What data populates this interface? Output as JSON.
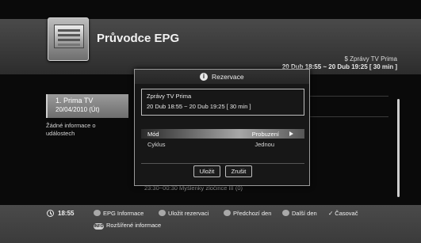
{
  "header": {
    "title": "Průvodce EPG",
    "current_channel": "$ Zprávy TV Prima",
    "current_time": "20 Dub 18:55 ~ 20 Dub 19:25 [ 30 min ]"
  },
  "channel_panel": {
    "name": "1. Prima TV",
    "date": "20/04/2010 (Út)",
    "info_line1": "Žádné informace o",
    "info_line2": "událostech"
  },
  "program_list": {
    "row_text": "23:30~00:30 Myšlenky zločince III (0)"
  },
  "dialog": {
    "title": "Rezervace",
    "event_channel": "Zprávy TV Prima",
    "event_time": "20 Dub 18:55 ~ 20 Dub 19:25 [ 30 min ]",
    "options": [
      {
        "label": "Mód",
        "value": "Probuzení"
      },
      {
        "label": "Cyklus",
        "value": "Jednou"
      }
    ],
    "save_label": "Uložit",
    "cancel_label": "Zrušit"
  },
  "footer": {
    "clock": "18:55",
    "legend": [
      {
        "label": "EPG Informace",
        "icon": "color-button-icon"
      },
      {
        "label": "Uložit rezervaci",
        "icon": "color-button-icon"
      },
      {
        "label": "Předchozí den",
        "icon": "color-button-icon"
      },
      {
        "label": "Další den",
        "icon": "color-button-icon"
      },
      {
        "label": "Časovač",
        "icon": "checkmark-icon"
      }
    ],
    "info_badge": "INFO",
    "info_label": "Rozšířené informace"
  }
}
